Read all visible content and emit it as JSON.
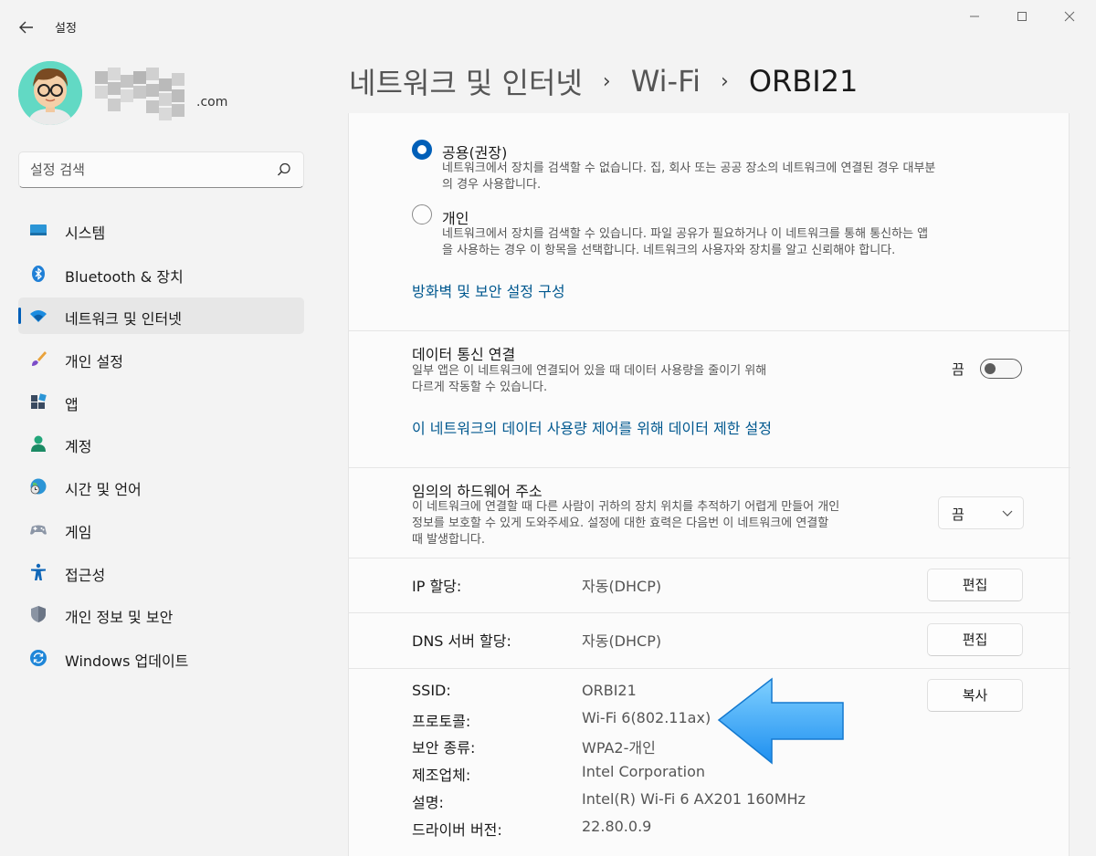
{
  "window": {
    "title": "설정",
    "back_glyph": "←",
    "min_glyph": "—",
    "max_glyph": "☐",
    "close_glyph": "✕"
  },
  "profile": {
    "account_suffix": ".com"
  },
  "search": {
    "placeholder": "설정 검색"
  },
  "sidebar": {
    "items": [
      {
        "label": "시스템"
      },
      {
        "label": "Bluetooth & 장치"
      },
      {
        "label": "네트워크 및 인터넷"
      },
      {
        "label": "개인 설정"
      },
      {
        "label": "앱"
      },
      {
        "label": "계정"
      },
      {
        "label": "시간 및 언어"
      },
      {
        "label": "게임"
      },
      {
        "label": "접근성"
      },
      {
        "label": "개인 정보 및 보안"
      },
      {
        "label": "Windows 업데이트"
      }
    ]
  },
  "breadcrumb": {
    "items": [
      "네트워크 및 인터넷",
      "Wi-Fi",
      "ORBI21"
    ],
    "separator": "›"
  },
  "profile_type": {
    "public": {
      "title": "공용(권장)",
      "desc_line1": "네트워크에서 장치를 검색할 수 없습니다. 집, 회사 또는 공공 장소의 네트워크에 연결된 경우 대부분",
      "desc_line2": "의 경우 사용합니다."
    },
    "private": {
      "title": "개인",
      "desc_line1": "네트워크에서 장치를 검색할 수 있습니다. 파일 공유가 필요하거나 이 네트워크를 통해 통신하는 앱",
      "desc_line2": "을 사용하는 경우 이 항목을 선택합니다. 네트워크의 사용자와 장치를 알고 신뢰해야 합니다."
    },
    "firewall_link": "방화벽 및 보안 설정 구성"
  },
  "metered": {
    "title": "데이터 통신 연결",
    "desc_line1": "일부 앱은 이 네트워크에 연결되어 있을 때 데이터 사용량을 줄이기 위해",
    "desc_line2": "다르게 작동할 수 있습니다.",
    "toggle_label": "끔",
    "data_limit_link": "이 네트워크의 데이터 사용량 제어를 위해 데이터 제한 설정"
  },
  "random_hw": {
    "title": "임의의 하드웨어 주소",
    "desc_line1": "이 네트워크에 연결할 때 다른 사람이 귀하의 장치 위치를 추적하기 어렵게 만들어 개인",
    "desc_line2": "정보를 보호할 수 있게 도와주세요. 설정에 대한 효력은 다음번 이 네트워크에 연결할",
    "desc_line3": "때 발생합니다.",
    "dropdown_value": "끔"
  },
  "ip": {
    "label": "IP 할당:",
    "value": "자동(DHCP)",
    "button": "편집"
  },
  "dns": {
    "label": "DNS 서버 할당:",
    "value": "자동(DHCP)",
    "button": "편집"
  },
  "properties": {
    "copy_button": "복사",
    "rows": [
      {
        "label": "SSID:",
        "value": "ORBI21"
      },
      {
        "label": "프로토콜:",
        "value": "Wi-Fi 6(802.11ax)"
      },
      {
        "label": "보안 종류:",
        "value": "WPA2-개인"
      },
      {
        "label": "제조업체:",
        "value": "Intel Corporation"
      },
      {
        "label": "설명:",
        "value": "Intel(R) Wi-Fi 6 AX201 160MHz"
      },
      {
        "label": "드라이버 버전:",
        "value": "22.80.0.9"
      }
    ]
  },
  "colors": {
    "accent": "#005fb8",
    "link": "#00588f",
    "arrow": "#2aa3f5"
  }
}
